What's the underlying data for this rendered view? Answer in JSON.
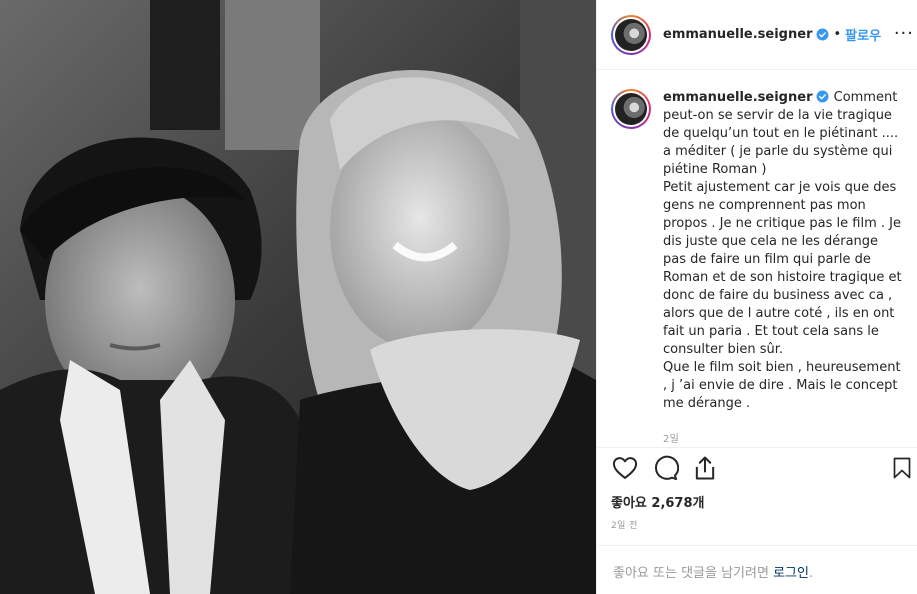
{
  "post": {
    "image_alt": "Black and white photo of a couple smiling"
  },
  "header": {
    "username": "emmanuelle.seigner",
    "separator": "•",
    "follow_label": "팔로우",
    "more_label": "···"
  },
  "caption": {
    "author": "emmanuelle.seigner",
    "text": " Comment peut-on se servir de la vie tragique de quelqu’un tout en le piétinant .... a méditer ( je parle du système qui piétine Roman )\nPetit ajustement car je vois que des gens ne comprennent pas mon propos . Je ne critique pas le film . Je dis juste que cela ne les dérange pas de faire un film qui parle de Roman et de son histoire tragique et donc de faire du business avec ca , alors que de l autre coté , ils en ont fait un paria . Et tout cela sans le consulter bien sûr.\nQue le film soit bien , heureusement , j ’ai envie de dire . Mais le concept me dérange .",
    "time": "2일"
  },
  "actions": {
    "like_icon": "heart-icon",
    "comment_icon": "comment-icon",
    "share_icon": "share-icon",
    "save_icon": "bookmark-icon"
  },
  "stats": {
    "likes_text": "좋아요 2,678개",
    "posted_time": "2일 전"
  },
  "login_bar": {
    "prefix": "좋아요 또는 댓글을 남기려면 ",
    "link": "로그인",
    "suffix": "."
  },
  "colors": {
    "accent": "#3897f0",
    "link_dark": "#003569",
    "muted": "#999999",
    "border": "#efefef"
  }
}
